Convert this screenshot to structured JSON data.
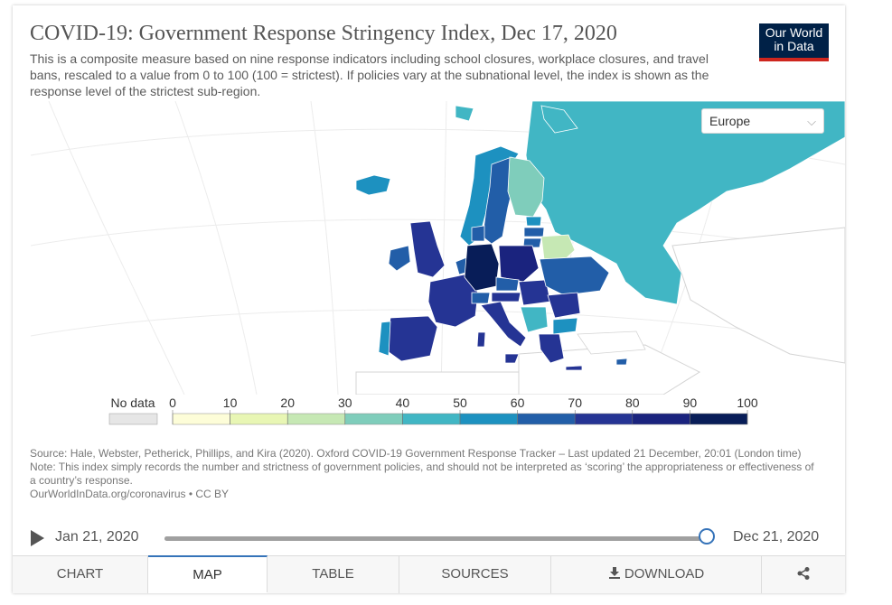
{
  "header": {
    "title": "COVID-19: Government Response Stringency Index, Dec 17, 2020",
    "subtitle": "This is a composite measure based on nine response indicators including school closures, workplace closures, and travel bans, rescaled to a value from 0 to 100 (100 = strictest). If policies vary at the subnational level, the index is shown as the response level of the strictest sub-region."
  },
  "logo": {
    "line1": "Our World",
    "line2": "in Data"
  },
  "region_select": {
    "value": "Europe",
    "icon": "chevron-down-icon"
  },
  "legend": {
    "no_data_label": "No data",
    "ticks": [
      "0",
      "10",
      "20",
      "30",
      "40",
      "50",
      "60",
      "70",
      "80",
      "90",
      "100"
    ],
    "bins": [
      {
        "color": "#fdfdd8"
      },
      {
        "color": "#e8f6b4"
      },
      {
        "color": "#c6e8b4"
      },
      {
        "color": "#7fcdbb"
      },
      {
        "color": "#41b6c4"
      },
      {
        "color": "#1d91c0"
      },
      {
        "color": "#225ea8"
      },
      {
        "color": "#253494"
      },
      {
        "color": "#1a237e"
      },
      {
        "color": "#081d58"
      }
    ],
    "no_data_color": "#e6e6e6"
  },
  "map_colors": {
    "ocean": "#ffffff",
    "land_unfilled": "#ffffff",
    "border": "#dddddd"
  },
  "source": {
    "line1": "Source: Hale, Webster, Petherick, Phillips, and Kira (2020). Oxford COVID-19 Government Response Tracker – Last updated 21 December, 20:01 (London time)",
    "line2": "Note: This index simply records the number and strictness of government policies, and should not be interpreted as ‘scoring’ the appropriateness or effectiveness of a country’s response.",
    "line3": "OurWorldInData.org/coronavirus • CC BY"
  },
  "timeline": {
    "start": "Jan 21, 2020",
    "end": "Dec 21, 2020",
    "position": 1.0
  },
  "tabs": [
    {
      "label": "CHART",
      "active": false
    },
    {
      "label": "MAP",
      "active": true
    },
    {
      "label": "TABLE",
      "active": false
    },
    {
      "label": "SOURCES",
      "active": false
    },
    {
      "label": "DOWNLOAD",
      "active": false,
      "icon": "download-icon"
    },
    {
      "label": "",
      "active": false,
      "icon": "share-icon"
    }
  ]
}
